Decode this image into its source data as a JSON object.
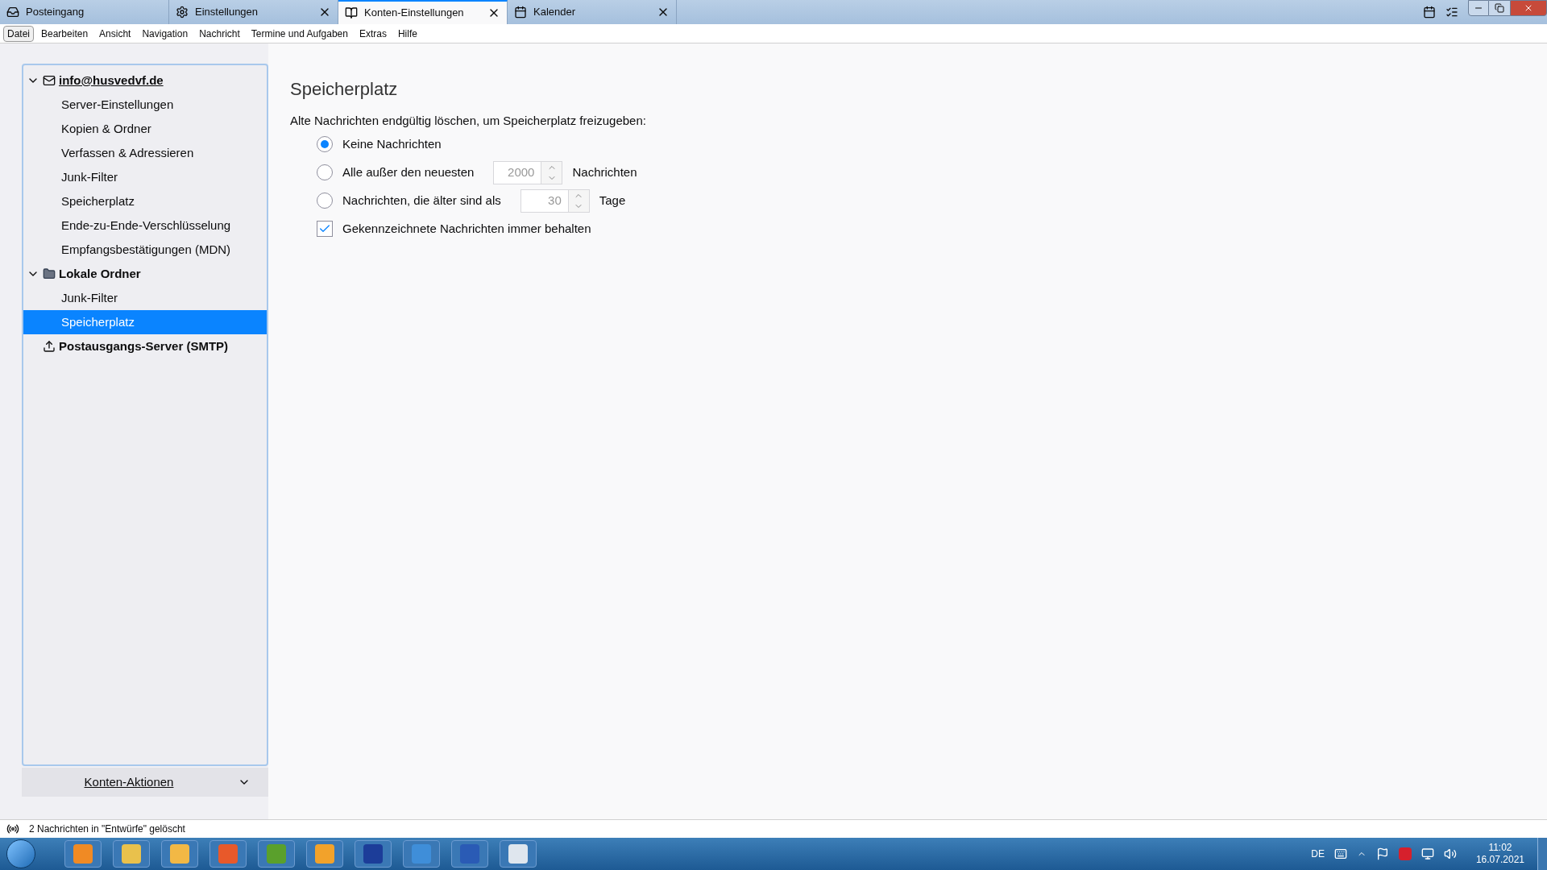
{
  "tabs": [
    {
      "label": "Posteingang",
      "selected": false,
      "closable": false
    },
    {
      "label": "Einstellungen",
      "selected": false,
      "closable": true
    },
    {
      "label": "Konten-Einstellungen",
      "selected": true,
      "closable": true
    },
    {
      "label": "Kalender",
      "selected": false,
      "closable": true
    }
  ],
  "menu": [
    {
      "label": "Datei",
      "selected": true
    },
    {
      "label": "Bearbeiten",
      "selected": false
    },
    {
      "label": "Ansicht",
      "selected": false
    },
    {
      "label": "Navigation",
      "selected": false
    },
    {
      "label": "Nachricht",
      "selected": false
    },
    {
      "label": "Termine und Aufgaben",
      "selected": false
    },
    {
      "label": "Extras",
      "selected": false
    },
    {
      "label": "Hilfe",
      "selected": false
    }
  ],
  "sidebar": {
    "accounts": [
      {
        "label": "info@husvedvf.de",
        "expanded": true,
        "underlined": true,
        "children": [
          {
            "label": "Server-Einstellungen",
            "selected": false
          },
          {
            "label": "Kopien & Ordner",
            "selected": false
          },
          {
            "label": "Verfassen & Adressieren",
            "selected": false
          },
          {
            "label": "Junk-Filter",
            "selected": false
          },
          {
            "label": "Speicherplatz",
            "selected": false
          },
          {
            "label": "Ende-zu-Ende-Verschlüsselung",
            "selected": false
          },
          {
            "label": "Empfangsbestätigungen (MDN)",
            "selected": false
          }
        ]
      },
      {
        "label": "Lokale Ordner",
        "expanded": true,
        "underlined": false,
        "children": [
          {
            "label": "Junk-Filter",
            "selected": false
          },
          {
            "label": "Speicherplatz",
            "selected": true
          }
        ]
      },
      {
        "label": "Postausgangs-Server (SMTP)",
        "underlined": false
      }
    ],
    "actions_button": "Konten-Aktionen"
  },
  "content": {
    "title": "Speicherplatz",
    "intro": "Alte Nachrichten endgültig löschen, um Speicherplatz freizugeben:",
    "options": [
      {
        "kind": "radio",
        "label": "Keine Nachrichten",
        "selected": true
      },
      {
        "kind": "radio",
        "label": "Alle außer den neuesten",
        "selected": false,
        "value": "2000",
        "unit": "Nachrichten"
      },
      {
        "kind": "radio",
        "label": "Nachrichten, die älter sind als",
        "selected": false,
        "value": "30",
        "unit": "Tage"
      },
      {
        "kind": "checkbox",
        "label": "Gekennzeichnete Nachrichten immer behalten",
        "checked": true
      }
    ]
  },
  "status_bar": {
    "text": "2 Nachrichten in \"Entwürfe\" gelöscht"
  },
  "taskbar": {
    "language": "DE",
    "time": "11:02",
    "date": "16.07.2021"
  }
}
